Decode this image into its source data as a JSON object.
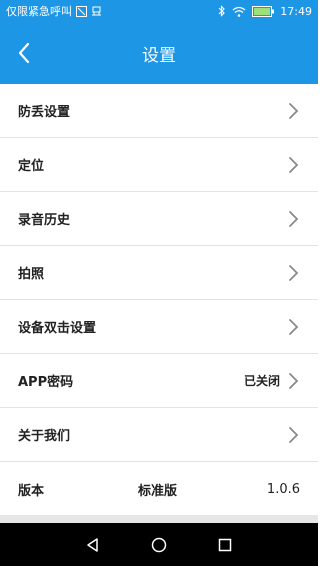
{
  "status_bar": {
    "carrier_text": "仅限紧急呼叫",
    "time": "17:49"
  },
  "header": {
    "title": "设置",
    "back_icon": "back-arrow-icon"
  },
  "settings": {
    "items": [
      {
        "label": "防丢设置",
        "value": ""
      },
      {
        "label": "定位",
        "value": ""
      },
      {
        "label": "录音历史",
        "value": ""
      },
      {
        "label": "拍照",
        "value": ""
      },
      {
        "label": "设备双击设置",
        "value": ""
      },
      {
        "label": "APP密码",
        "value": "已关闭"
      },
      {
        "label": "关于我们",
        "value": ""
      }
    ],
    "version": {
      "label": "版本",
      "edition": "标准版",
      "number": "1.0.6"
    }
  },
  "colors": {
    "primary": "#1e96e6",
    "divider": "#e3e3e3",
    "nav_bar": "#000000"
  }
}
